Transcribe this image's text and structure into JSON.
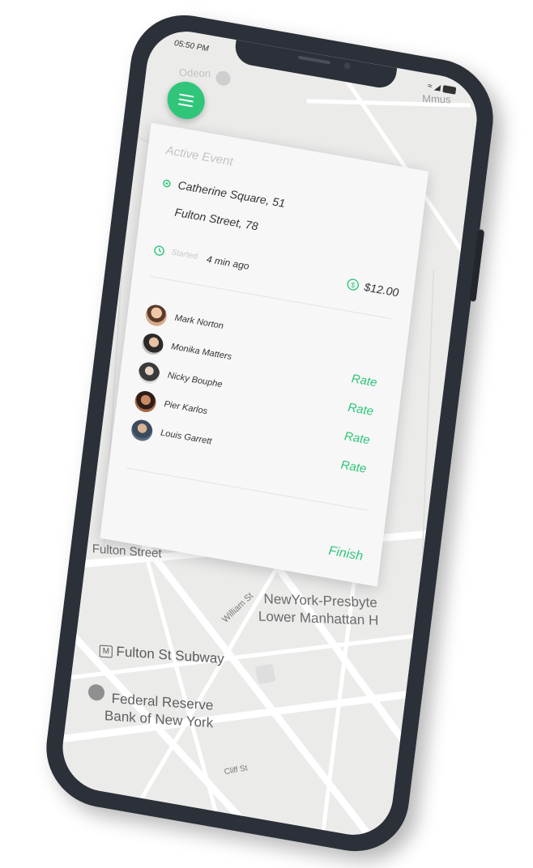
{
  "status_bar": {
    "time": "05:50 PM"
  },
  "map": {
    "labels": {
      "odeon": "Odeon",
      "mmus": "Mmus",
      "fulton_street": "Fulton Street",
      "william_st": "William St",
      "hospital_1": "NewYork-Presbyte",
      "hospital_2": "Lower Manhattan H",
      "subway": "Fulton St Subway",
      "fed_1": "Federal Reserve",
      "fed_2": "Bank of New York",
      "cliff_st": "Cliff St"
    }
  },
  "card": {
    "title": "Active Event",
    "address_from": "Catherine Square, 51",
    "address_to": "Fulton Street, 78",
    "started_label": "Started",
    "started_value": "4 min ago",
    "price": "$12.00",
    "finish_label": "Finish",
    "passengers": [
      {
        "name": "Mark Norton",
        "rate_label": ""
      },
      {
        "name": "Monika Matters",
        "rate_label": "Rate"
      },
      {
        "name": "Nicky Bouphe",
        "rate_label": "Rate"
      },
      {
        "name": "Pier Karlos",
        "rate_label": "Rate"
      },
      {
        "name": "Louis Garrett",
        "rate_label": "Rate"
      }
    ]
  },
  "colors": {
    "accent": "#2fc67a",
    "phone_body": "#2c3038",
    "map_bg": "#ebebea"
  }
}
